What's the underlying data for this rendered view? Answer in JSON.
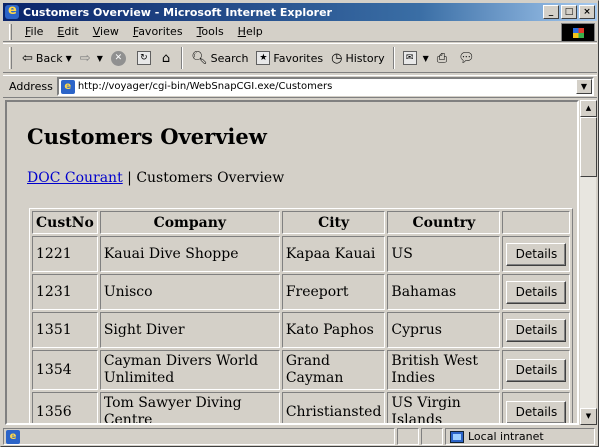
{
  "window": {
    "title": "Customers Overview - Microsoft Internet Explorer",
    "controls": {
      "minimize": "_",
      "maximize": "□",
      "close": "×"
    }
  },
  "menubar": {
    "items": [
      "File",
      "Edit",
      "View",
      "Favorites",
      "Tools",
      "Help"
    ]
  },
  "toolbar": {
    "back": "Back",
    "search": "Search",
    "favorites": "Favorites",
    "history": "History"
  },
  "address": {
    "label": "Address",
    "url": "http://voyager/cgi-bin/WebSnapCGI.exe/Customers"
  },
  "page": {
    "title": "Customers Overview",
    "breadcrumb_link": "DOC Courant",
    "breadcrumb_sep": " | ",
    "breadcrumb_current": "Customers Overview"
  },
  "table": {
    "columns": [
      "CustNo",
      "Company",
      "City",
      "Country",
      ""
    ],
    "details_label": "Details",
    "rows": [
      {
        "custno": "1221",
        "company": "Kauai Dive Shoppe",
        "city": "Kapaa Kauai",
        "country": "US"
      },
      {
        "custno": "1231",
        "company": "Unisco",
        "city": "Freeport",
        "country": "Bahamas"
      },
      {
        "custno": "1351",
        "company": "Sight Diver",
        "city": "Kato Paphos",
        "country": "Cyprus"
      },
      {
        "custno": "1354",
        "company": "Cayman Divers World Unlimited",
        "city": "Grand Cayman",
        "country": "British West Indies"
      },
      {
        "custno": "1356",
        "company": "Tom Sawyer Diving Centre",
        "city": "Christiansted",
        "country": "US Virgin Islands"
      }
    ]
  },
  "statusbar": {
    "zone": "Local intranet"
  }
}
